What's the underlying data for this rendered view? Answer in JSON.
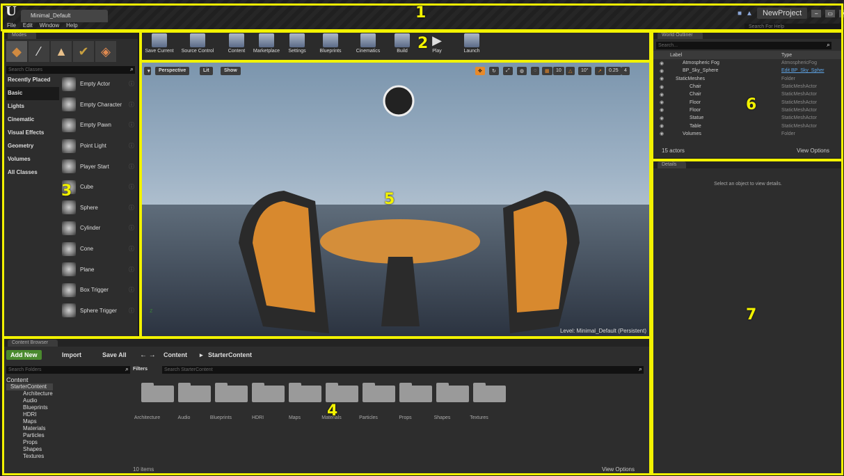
{
  "titlebar": {
    "logo": "U",
    "doc_tab": "Minimal_Default",
    "project": "NewProject",
    "help_search": "Search For Help",
    "menu": [
      "File",
      "Edit",
      "Window",
      "Help"
    ],
    "win_buttons": [
      "–",
      "▭",
      "✕"
    ]
  },
  "modes": {
    "tab": "Modes",
    "search_placeholder": "Search Classes",
    "categories": [
      "Recently Placed",
      "Basic",
      "Lights",
      "Cinematic",
      "Visual Effects",
      "Geometry",
      "Volumes",
      "All Classes"
    ],
    "items": [
      "Empty Actor",
      "Empty Character",
      "Empty Pawn",
      "Point Light",
      "Player Start",
      "Cube",
      "Sphere",
      "Cylinder",
      "Cone",
      "Plane",
      "Box Trigger",
      "Sphere Trigger"
    ]
  },
  "toolbar": {
    "buttons": [
      "Save Current",
      "Source Control",
      "Content",
      "Marketplace",
      "Settings",
      "Blueprints",
      "Cinematics",
      "Build",
      "Play",
      "Launch"
    ]
  },
  "viewport": {
    "perspective": "Perspective",
    "lit": "Lit",
    "show": "Show",
    "grid": "10",
    "angle": "10°",
    "scale": "0.25",
    "cam": "4",
    "level": "Level:  Minimal_Default (Persistent)"
  },
  "outliner": {
    "tab": "World Outliner",
    "search_placeholder": "Search...",
    "col_label": "Label",
    "col_type": "Type",
    "rows": [
      {
        "label": "Atmospheric Fog",
        "type": "AtmosphericFog"
      },
      {
        "label": "BP_Sky_Sphere",
        "type": "Edit BP_Sky_Spher"
      },
      {
        "label": "StaticMeshes",
        "type": "Folder"
      },
      {
        "label": "Chair",
        "type": "StaticMeshActor"
      },
      {
        "label": "Chair",
        "type": "StaticMeshActor"
      },
      {
        "label": "Floor",
        "type": "StaticMeshActor"
      },
      {
        "label": "Floor",
        "type": "StaticMeshActor"
      },
      {
        "label": "Statue",
        "type": "StaticMeshActor"
      },
      {
        "label": "Table",
        "type": "StaticMeshActor"
      },
      {
        "label": "Volumes",
        "type": "Folder"
      }
    ],
    "count": "15 actors",
    "view_options": "View Options"
  },
  "details": {
    "tab": "Details",
    "hint": "Select an object to view details."
  },
  "content_browser": {
    "tab": "Content Browser",
    "add_new": "Add New",
    "import": "Import",
    "save_all": "Save All",
    "path": [
      "Content",
      "StarterContent"
    ],
    "filters": "Filters",
    "search_folders": "Search Folders",
    "search_content": "Search StarterContent",
    "tree": [
      "Content",
      "StarterContent",
      "Architecture",
      "Audio",
      "Blueprints",
      "HDRI",
      "Maps",
      "Materials",
      "Particles",
      "Props",
      "Shapes",
      "Textures"
    ],
    "folders": [
      "Architecture",
      "Audio",
      "Blueprints",
      "HDRI",
      "Maps",
      "Materials",
      "Particles",
      "Props",
      "Shapes",
      "Textures"
    ],
    "item_count": "10 items",
    "view_options": "View Options"
  },
  "markers": [
    "1",
    "2",
    "3",
    "4",
    "5",
    "6",
    "7"
  ]
}
